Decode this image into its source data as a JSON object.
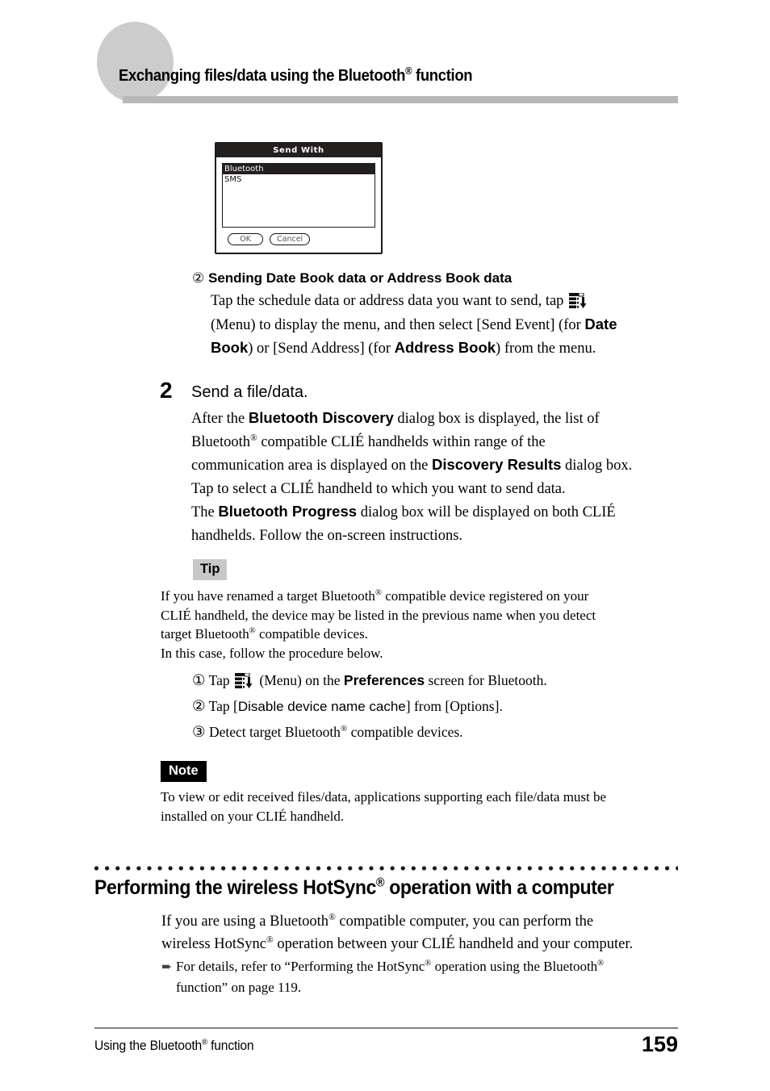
{
  "header": {
    "title_pre": "Exchanging files/data using the Bluetooth",
    "title_post": " function",
    "reg": "®",
    "bar_color": "#b8b8b8",
    "circle_color": "#cccccc"
  },
  "pda_dialog": {
    "title": "Send With",
    "list": [
      {
        "label": "Bluetooth",
        "selected": true
      },
      {
        "label": "SMS",
        "selected": false
      }
    ],
    "buttons": [
      {
        "label": "OK",
        "name": "ok-button"
      },
      {
        "label": "Cancel",
        "name": "cancel-button"
      }
    ]
  },
  "substep_2": {
    "marker": "②",
    "heading": "Sending Date Book data or Address Book data",
    "line1_a": "Tap the schedule data or address data you want to send, tap",
    "line2_a": "(Menu) to display the menu, and then select [Send Event] (for ",
    "line2_bold": "Date",
    "line3_bold": "Book",
    "line3_a": ") or [Send Address] (for ",
    "line3_bold2": "Address Book",
    "line3_b": ") from the menu.",
    "menu_icon": "menu-icon"
  },
  "step": {
    "number": "2",
    "title": "Send a file/data.",
    "body": {
      "l1_a": "After the ",
      "l1_b": "Bluetooth Discovery",
      "l1_c": " dialog box is displayed, the list of",
      "l2_a": "Bluetooth",
      "l2_reg": "®",
      "l2_b": " compatible CLIÉ handhelds within range of the",
      "l3_a": "communication area is displayed on the ",
      "l3_b": "Discovery Results",
      "l3_c": " dialog box.",
      "l4": "Tap to select a CLIÉ handheld to which you want to send data.",
      "l5_a": "The ",
      "l5_b": "Bluetooth Progress",
      "l5_c": " dialog box will be displayed on both CLIÉ",
      "l6": "handhelds. Follow the on-screen instructions."
    }
  },
  "tip": {
    "label": "Tip",
    "l1_a": "If you have renamed a target Bluetooth",
    "l1_reg": "®",
    "l1_b": " compatible device registered on your",
    "l2": "CLIÉ handheld, the device may be listed in the previous name when you detect",
    "l3_a": "target Bluetooth",
    "l3_reg": "®",
    "l3_b": " compatible devices.",
    "l4": "In this case, follow the procedure below.",
    "items": [
      {
        "marker": "①",
        "pre": "Tap",
        "has_icon": true,
        "mid_a": "(Menu) on the ",
        "bold": "Preferences",
        "post": " screen for Bluetooth."
      },
      {
        "marker": "②",
        "pre": "Tap [",
        "has_icon": false,
        "sans_text": "Disable device name cache",
        "post": "] from [Options]."
      },
      {
        "marker": "③",
        "pre": "Detect target Bluetooth",
        "has_icon": false,
        "reg": "®",
        "post": " compatible devices."
      }
    ]
  },
  "note": {
    "label": "Note",
    "l1": "To view or edit received files/data, applications supporting each file/data must be",
    "l2": "installed on your CLIÉ handheld."
  },
  "section": {
    "head_a": "Performing the wireless HotSync",
    "head_reg": "®",
    "head_b": " operation with a computer",
    "p1_a": "If you are using a Bluetooth",
    "p1_reg": "®",
    "p1_b": " compatible computer, you can perform the",
    "p2_a": "wireless HotSync",
    "p2_reg": "®",
    "p2_b": " operation between your CLIÉ handheld and your computer.",
    "ref_arrow": "➨",
    "ref_a": "For details, refer to “Performing the HotSync",
    "ref_reg1": "®",
    "ref_b": " operation using the Bluetooth",
    "ref_reg2": "®",
    "ref_c": "function” on page 119."
  },
  "footer": {
    "left_a": "Using the Bluetooth",
    "left_reg": "®",
    "left_b": " function",
    "page": "159"
  }
}
